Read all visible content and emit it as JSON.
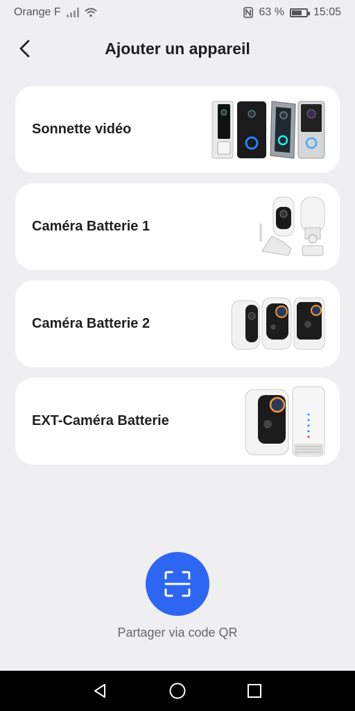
{
  "status_bar": {
    "carrier": "Orange F",
    "battery_percent": "63 %",
    "battery_level": 0.63,
    "time": "15:05",
    "icons": [
      "signal-icon",
      "wifi-icon",
      "nfc-icon",
      "battery-icon"
    ]
  },
  "header": {
    "title": "Ajouter un appareil",
    "back_icon": "chevron-left-icon"
  },
  "devices": [
    {
      "name": "Sonnette vidéo",
      "image": "video-doorbell-image"
    },
    {
      "name": "Caméra Batterie 1",
      "image": "battery-camera-1-image"
    },
    {
      "name": "Caméra Batterie 2",
      "image": "battery-camera-2-image"
    },
    {
      "name": "EXT-Caméra Batterie",
      "image": "ext-battery-camera-image"
    }
  ],
  "qr_share": {
    "label": "Partager via code QR",
    "icon": "qr-scan-icon",
    "color": "#2d66f0"
  },
  "nav_bar": {
    "icons": [
      "back-triangle-icon",
      "home-circle-icon",
      "recents-square-icon"
    ]
  }
}
